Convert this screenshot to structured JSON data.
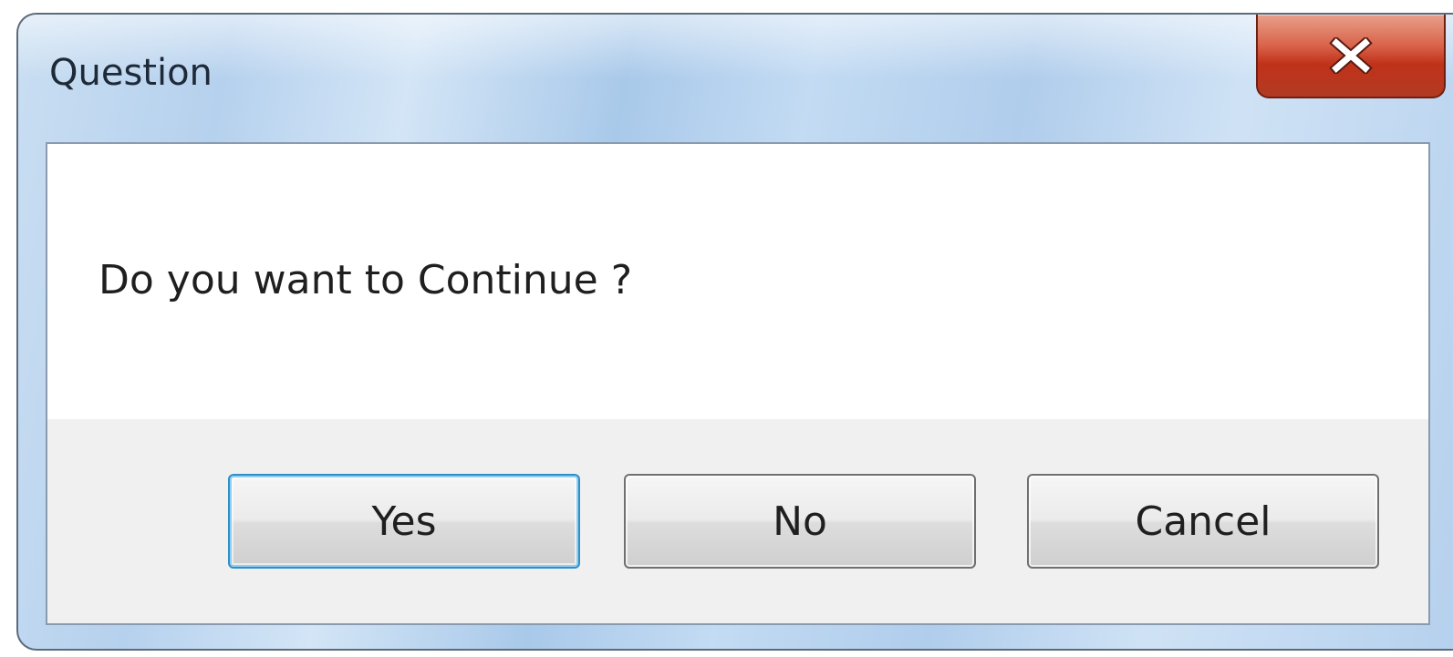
{
  "dialog": {
    "title": "Question",
    "message": "Do you want to Continue ?",
    "close_icon": "close-x-icon",
    "buttons": {
      "yes": "Yes",
      "no": "No",
      "cancel": "Cancel"
    },
    "default_button": "yes"
  },
  "colors": {
    "title_bar": "#b6d1ee",
    "close_button": "#c0321a",
    "dialog_body": "#f0f0f0",
    "message_area": "#ffffff",
    "default_button_border": "#2f8fc6"
  }
}
